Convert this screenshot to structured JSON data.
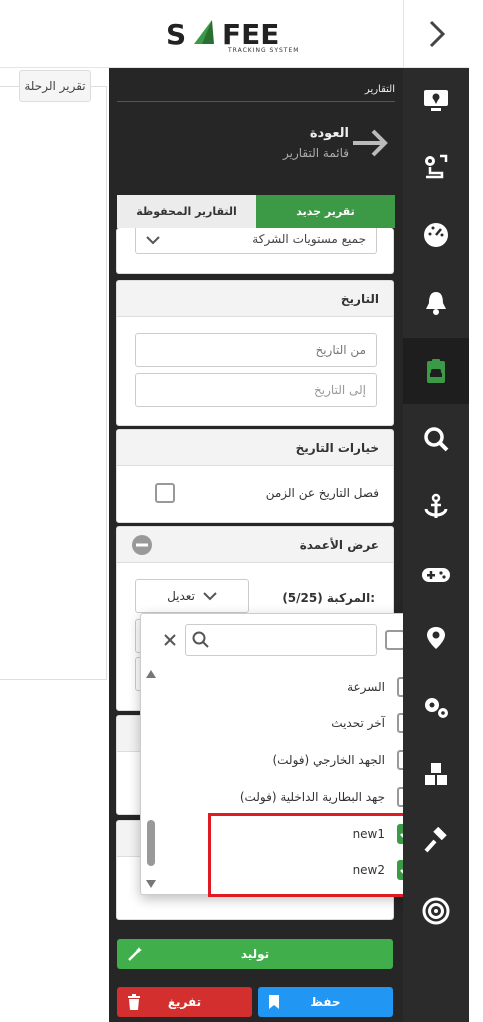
{
  "header": {
    "logo_text": "SAFEE",
    "logo_tagline": "TRACKING SYSTEM",
    "toggle_icon": "chevron-right-icon"
  },
  "left": {
    "trip_report_tab": "تقرير الرحلة"
  },
  "sidebar": {
    "items": [
      {
        "icon": "monitor-location-icon"
      },
      {
        "icon": "route-icon"
      },
      {
        "icon": "speedometer-icon"
      },
      {
        "icon": "bell-icon"
      },
      {
        "icon": "clipboard-car-icon",
        "active": true
      },
      {
        "icon": "search-icon"
      },
      {
        "icon": "anchor-icon"
      },
      {
        "icon": "gamepad-icon"
      },
      {
        "icon": "map-pin-icon"
      },
      {
        "icon": "gears-icon"
      },
      {
        "icon": "cubes-icon"
      },
      {
        "icon": "gavel-icon"
      },
      {
        "icon": "target-icon"
      }
    ]
  },
  "panel": {
    "title": "التقارير",
    "back_title": "العودة",
    "back_subtitle": "قائمة التقارير",
    "tabs": {
      "new_report": "تقرير جديد",
      "saved_reports": "التقارير المحفوظة"
    },
    "company_select": "جميع مستويات الشركة",
    "date_section": {
      "title": "التاريخ",
      "from_placeholder": "من التاريخ",
      "to_placeholder": "إلى التاريخ"
    },
    "date_options": {
      "title": "خيارات التاريخ",
      "separate_label": "فصل التاريخ عن الزمن"
    },
    "columns": {
      "title": "عرض الأعمدة",
      "vehicle_label": "المركبة (5/25):",
      "edit_dropdown": "تعديل"
    }
  },
  "popup": {
    "search_value": "",
    "items": [
      {
        "label": "السرعة",
        "checked": false
      },
      {
        "label": "آخر تحديث",
        "checked": false
      },
      {
        "label": "الجهد الخارجي (فولت)",
        "checked": false
      },
      {
        "label": "جهد البطارية الداخلية (فولت)",
        "checked": false
      },
      {
        "label": "new1",
        "checked": true
      },
      {
        "label": "new2",
        "checked": true
      }
    ]
  },
  "footer": {
    "generate": "توليد",
    "save": "حفظ",
    "clear": "تفريغ"
  },
  "colors": {
    "green": "#3c9a47",
    "blue": "#2196f3",
    "red": "#d32f2f",
    "highlight": "#e11b24",
    "sidebar": "#2b2b2b"
  }
}
